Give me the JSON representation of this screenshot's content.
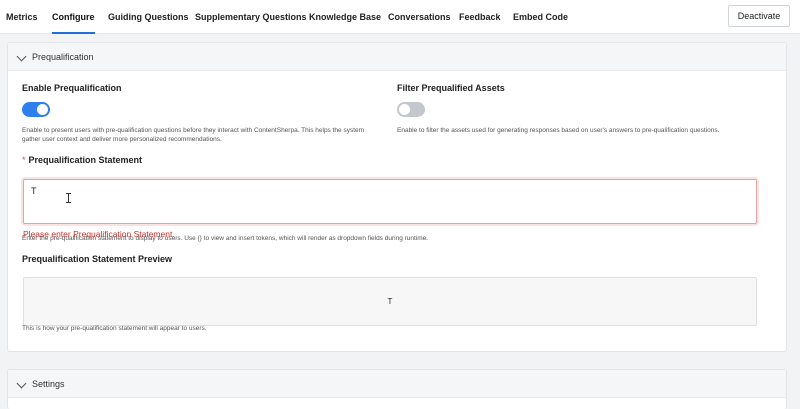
{
  "tabs": [
    {
      "label": "Metrics"
    },
    {
      "label": "Configure",
      "active": true
    },
    {
      "label": "Guiding Questions"
    },
    {
      "label": "Supplementary Questions"
    },
    {
      "label": "Knowledge Base"
    },
    {
      "label": "Conversations"
    },
    {
      "label": "Feedback"
    },
    {
      "label": "Embed Code"
    }
  ],
  "header": {
    "deactivate_label": "Deactivate"
  },
  "prequal": {
    "section_title": "Prequalification",
    "enable_label": "Enable Prequalification",
    "enable_on": true,
    "enable_help": "Enable to present users with pre-qualification questions before they interact with ContentSherpa. This helps the system gather user context and deliver more personalized recommendations.",
    "filter_label": "Filter Prequalified Assets",
    "filter_on": false,
    "filter_help": "Enable to filter the assets used for generating responses based on user's answers to pre-qualification questions.",
    "required_marker": "*",
    "statement_label": "Prequalification Statement",
    "statement_value": "T",
    "statement_error": "Please enter Prequalification Statement.",
    "statement_help": "Enter the pre-qualification statement to display to users. Use {} to view and insert tokens, which will render as dropdown fields during runtime.",
    "preview_label": "Prequalification Statement Preview",
    "preview_value": "T",
    "preview_help": "This is how your pre-qualification statement will appear to users."
  },
  "settings": {
    "section_title": "Settings"
  },
  "colors": {
    "accent": "#2f80ed",
    "error": "#c9302c",
    "toggle_off": "#c4c7cc"
  }
}
